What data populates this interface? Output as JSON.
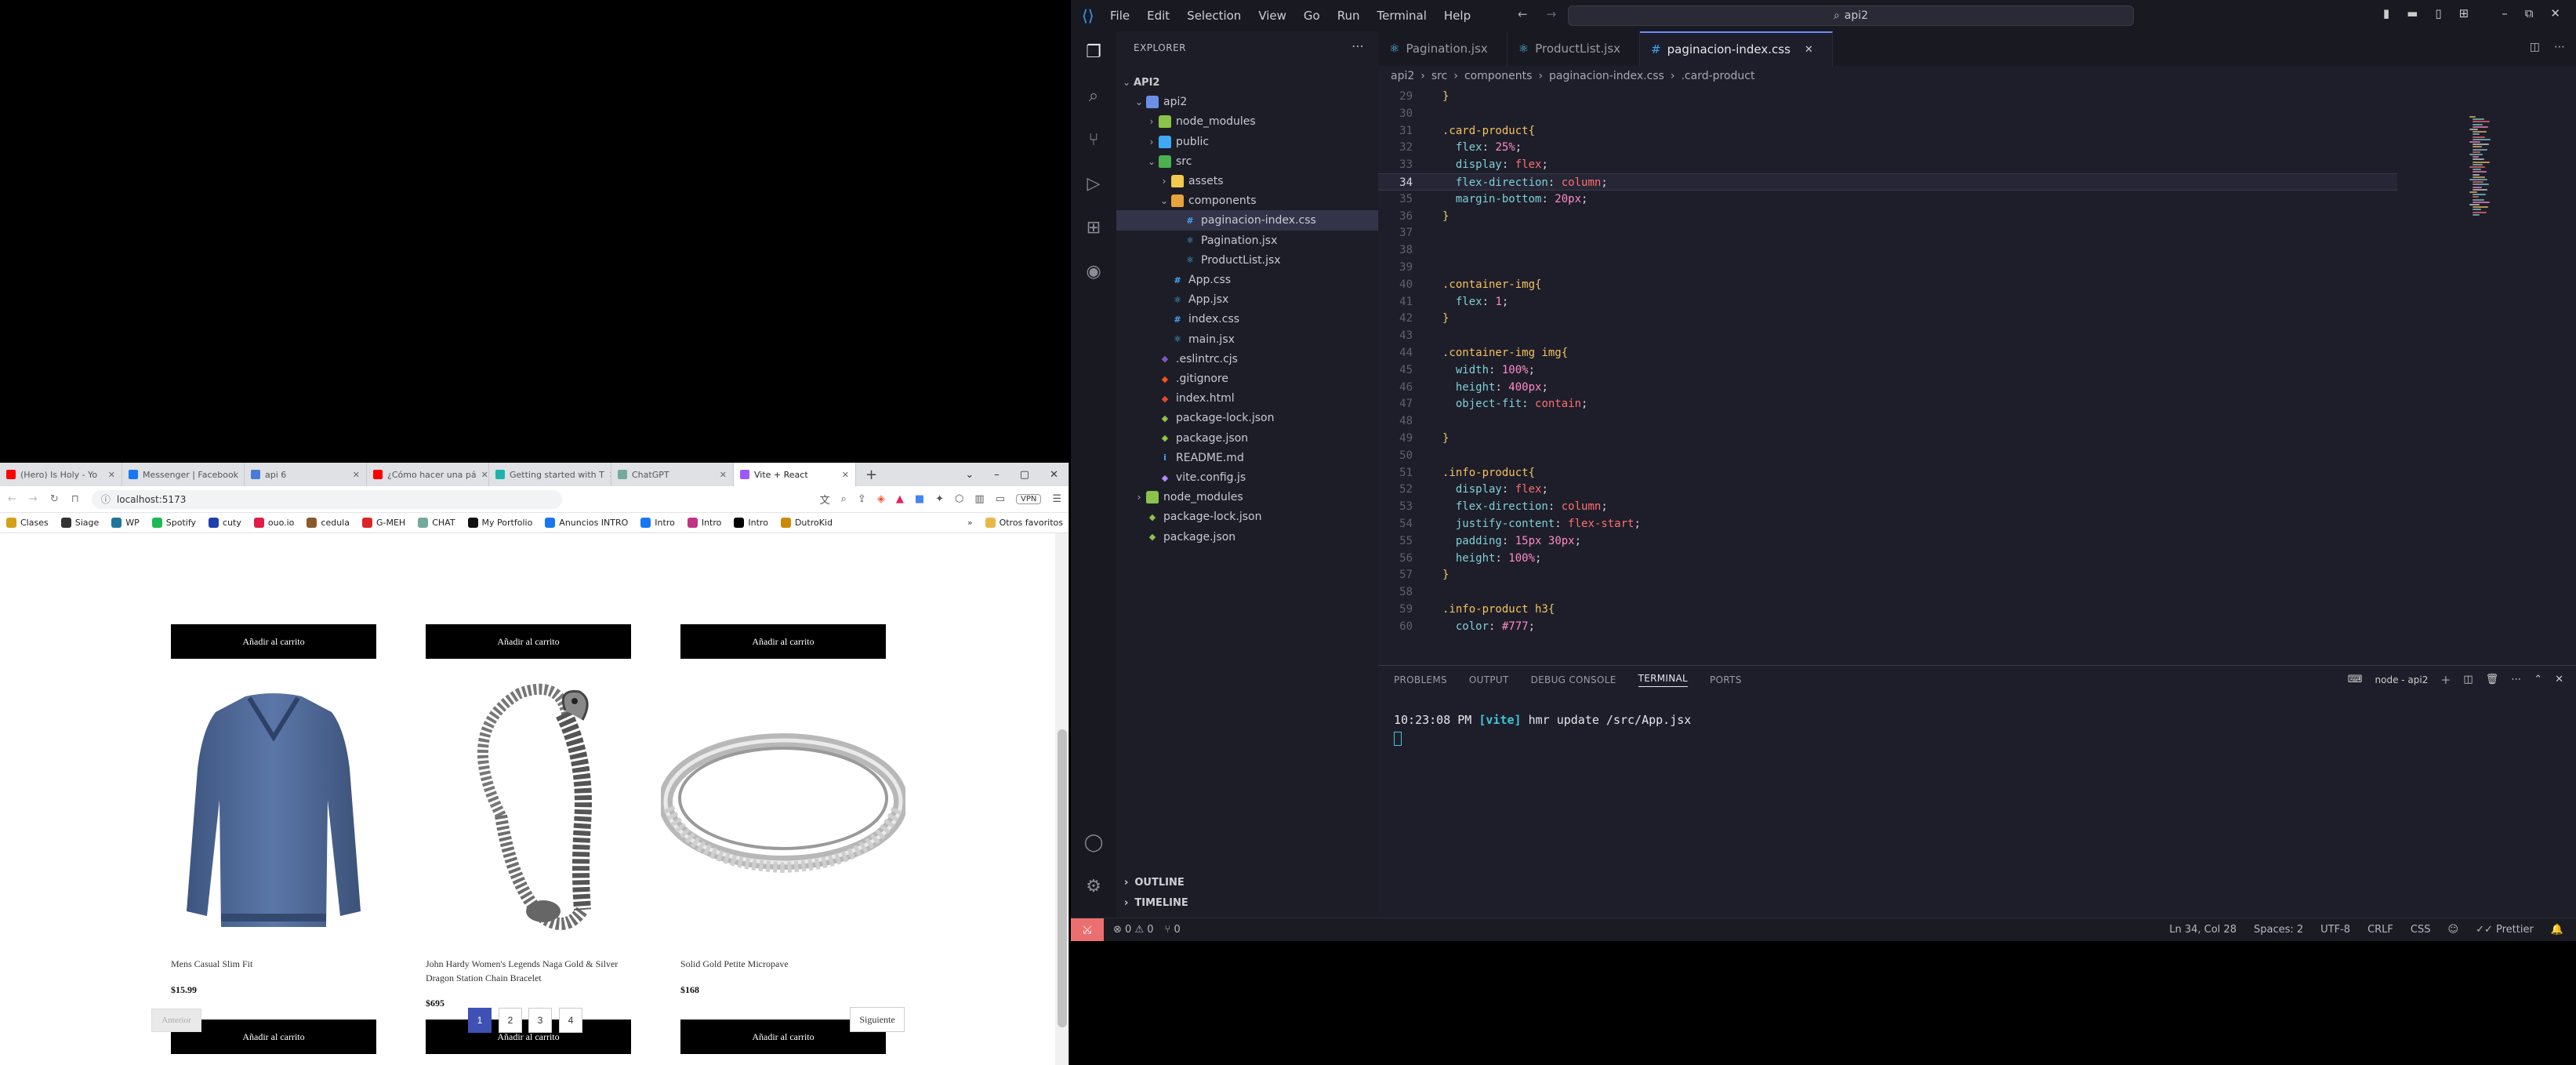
{
  "browser": {
    "tabs": [
      {
        "label": "(Hero) Is Holy - Yo",
        "icon": "youtube-icon",
        "color": "#ff0000",
        "active": false
      },
      {
        "label": "Messenger | Facebook",
        "icon": "facebook-icon",
        "color": "#1877f2",
        "active": false
      },
      {
        "label": "api 6",
        "icon": "page-icon",
        "color": "#4a7bd8",
        "active": false
      },
      {
        "label": "¿Cómo hacer una pá",
        "icon": "youtube-icon",
        "color": "#ff0000",
        "active": false
      },
      {
        "label": "Getting started with T",
        "icon": "docs-icon",
        "color": "#20b2aa",
        "active": false
      },
      {
        "label": "ChatGPT",
        "icon": "chatgpt-icon",
        "color": "#74aa9c",
        "active": false
      },
      {
        "label": "Vite + React",
        "icon": "vite-icon",
        "color": "#9b59ff",
        "active": true
      }
    ],
    "url": "localhost:5173",
    "vpn_label": "VPN",
    "bookmarks": [
      {
        "label": "Clases",
        "color": "#d4a017"
      },
      {
        "label": "Siage",
        "color": "#333333"
      },
      {
        "label": "WP",
        "color": "#21759b"
      },
      {
        "label": "Spotify",
        "color": "#1db954"
      },
      {
        "label": "cuty",
        "color": "#1e40af"
      },
      {
        "label": "ouo.io",
        "color": "#e11d48"
      },
      {
        "label": "cedula",
        "color": "#8b5a2b"
      },
      {
        "label": "G-MEH",
        "color": "#dc2626"
      },
      {
        "label": "CHAT",
        "color": "#74aa9c"
      },
      {
        "label": "My Portfolio",
        "color": "#111111"
      },
      {
        "label": "Anuncios INTRO",
        "color": "#1877f2"
      },
      {
        "label": "Intro",
        "color": "#1877f2"
      },
      {
        "label": "Intro",
        "color": "#c13584"
      },
      {
        "label": "Intro",
        "color": "#000000"
      },
      {
        "label": "DutroKid",
        "color": "#ca8a04"
      }
    ],
    "other_favorites": "Otros favoritos",
    "products": [
      {
        "name": "Mens Casual Slim Fit",
        "price": "$15.99",
        "image": "blue-shirt"
      },
      {
        "name": "John Hardy Women's Legends Naga Gold & Silver Dragon Station Chain Bracelet",
        "price": "$695",
        "image": "dragon-bracelet"
      },
      {
        "name": "Solid Gold Petite Micropave",
        "price": "$168",
        "image": "silver-ring"
      }
    ],
    "cart_label": "Añadir al carrito",
    "pagination": {
      "prev": "Anterior",
      "next": "Siguiente",
      "pages": [
        "1",
        "2",
        "3",
        "4"
      ],
      "current": "1"
    }
  },
  "vscode": {
    "menu": [
      "File",
      "Edit",
      "Selection",
      "View",
      "Go",
      "Run",
      "Terminal",
      "Help"
    ],
    "search": "api2",
    "explorer_title": "EXPLORER",
    "tree": [
      {
        "label": "API2",
        "depth": 0,
        "chev": "⌄",
        "icon": "",
        "bold": true
      },
      {
        "label": "api2",
        "depth": 1,
        "chev": "⌄",
        "icon": "folder"
      },
      {
        "label": "node_modules",
        "depth": 2,
        "chev": "›",
        "icon": "folder-node"
      },
      {
        "label": "public",
        "depth": 2,
        "chev": "›",
        "icon": "folder-public"
      },
      {
        "label": "src",
        "depth": 2,
        "chev": "⌄",
        "icon": "folder-src"
      },
      {
        "label": "assets",
        "depth": 3,
        "chev": "›",
        "icon": "folder-assets"
      },
      {
        "label": "components",
        "depth": 3,
        "chev": "⌄",
        "icon": "folder-components"
      },
      {
        "label": "paginacion-index.css",
        "depth": 4,
        "chev": "",
        "icon": "css",
        "selected": true
      },
      {
        "label": "Pagination.jsx",
        "depth": 4,
        "chev": "",
        "icon": "react"
      },
      {
        "label": "ProductList.jsx",
        "depth": 4,
        "chev": "",
        "icon": "react"
      },
      {
        "label": "App.css",
        "depth": 3,
        "chev": "",
        "icon": "css"
      },
      {
        "label": "App.jsx",
        "depth": 3,
        "chev": "",
        "icon": "react"
      },
      {
        "label": "index.css",
        "depth": 3,
        "chev": "",
        "icon": "css"
      },
      {
        "label": "main.jsx",
        "depth": 3,
        "chev": "",
        "icon": "react"
      },
      {
        "label": ".eslintrc.cjs",
        "depth": 2,
        "chev": "",
        "icon": "eslint"
      },
      {
        "label": ".gitignore",
        "depth": 2,
        "chev": "",
        "icon": "git"
      },
      {
        "label": "index.html",
        "depth": 2,
        "chev": "",
        "icon": "html"
      },
      {
        "label": "package-lock.json",
        "depth": 2,
        "chev": "",
        "icon": "node"
      },
      {
        "label": "package.json",
        "depth": 2,
        "chev": "",
        "icon": "node"
      },
      {
        "label": "README.md",
        "depth": 2,
        "chev": "",
        "icon": "info"
      },
      {
        "label": "vite.config.js",
        "depth": 2,
        "chev": "",
        "icon": "vite"
      },
      {
        "label": "node_modules",
        "depth": 1,
        "chev": "›",
        "icon": "folder-node"
      },
      {
        "label": "package-lock.json",
        "depth": 1,
        "chev": "",
        "icon": "node"
      },
      {
        "label": "package.json",
        "depth": 1,
        "chev": "",
        "icon": "node"
      }
    ],
    "outline": "OUTLINE",
    "timeline": "TIMELINE",
    "tabs": [
      {
        "label": "Pagination.jsx",
        "active": false
      },
      {
        "label": "ProductList.jsx",
        "active": false
      },
      {
        "label": "paginacion-index.css",
        "active": true
      }
    ],
    "breadcrumbs": [
      "api2",
      "src",
      "components",
      "paginacion-index.css",
      ".card-product"
    ],
    "current_line": "34",
    "code": [
      {
        "n": "29",
        "t": "}"
      },
      {
        "n": "30",
        "t": ""
      },
      {
        "n": "31",
        "t": ".card-product{"
      },
      {
        "n": "32",
        "t": "  flex: 25%;"
      },
      {
        "n": "33",
        "t": "  display: flex;"
      },
      {
        "n": "34",
        "t": "  flex-direction: column;"
      },
      {
        "n": "35",
        "t": "  margin-bottom: 20px;"
      },
      {
        "n": "36",
        "t": "}"
      },
      {
        "n": "37",
        "t": ""
      },
      {
        "n": "38",
        "t": ""
      },
      {
        "n": "39",
        "t": ""
      },
      {
        "n": "40",
        "t": ".container-img{"
      },
      {
        "n": "41",
        "t": "  flex: 1;"
      },
      {
        "n": "42",
        "t": "}"
      },
      {
        "n": "43",
        "t": ""
      },
      {
        "n": "44",
        "t": ".container-img img{"
      },
      {
        "n": "45",
        "t": "  width: 100%;"
      },
      {
        "n": "46",
        "t": "  height: 400px;"
      },
      {
        "n": "47",
        "t": "  object-fit: contain;"
      },
      {
        "n": "48",
        "t": ""
      },
      {
        "n": "49",
        "t": "}"
      },
      {
        "n": "50",
        "t": ""
      },
      {
        "n": "51",
        "t": ".info-product{"
      },
      {
        "n": "52",
        "t": "  display: flex;"
      },
      {
        "n": "53",
        "t": "  flex-direction: column;"
      },
      {
        "n": "54",
        "t": "  justify-content: flex-start;"
      },
      {
        "n": "55",
        "t": "  padding: 15px 30px;"
      },
      {
        "n": "56",
        "t": "  height: 100%;"
      },
      {
        "n": "57",
        "t": "}"
      },
      {
        "n": "58",
        "t": ""
      },
      {
        "n": "59",
        "t": ".info-product h3{"
      },
      {
        "n": "60",
        "t": "  color: #777;"
      }
    ],
    "panel_tabs": [
      "PROBLEMS",
      "OUTPUT",
      "DEBUG CONSOLE",
      "TERMINAL",
      "PORTS"
    ],
    "panel_active": "TERMINAL",
    "terminal_name": "node - api2",
    "terminal": {
      "time": "10:23:08 PM",
      "tag": "[vite]",
      "msg": "hmr update /src/App.jsx"
    },
    "status": {
      "errors": "0",
      "warnings": "0",
      "ports": "0",
      "position": "Ln 34, Col 28",
      "spaces": "Spaces: 2",
      "encoding": "UTF-8",
      "eol": "CRLF",
      "language": "CSS",
      "formatter": "Prettier"
    }
  }
}
